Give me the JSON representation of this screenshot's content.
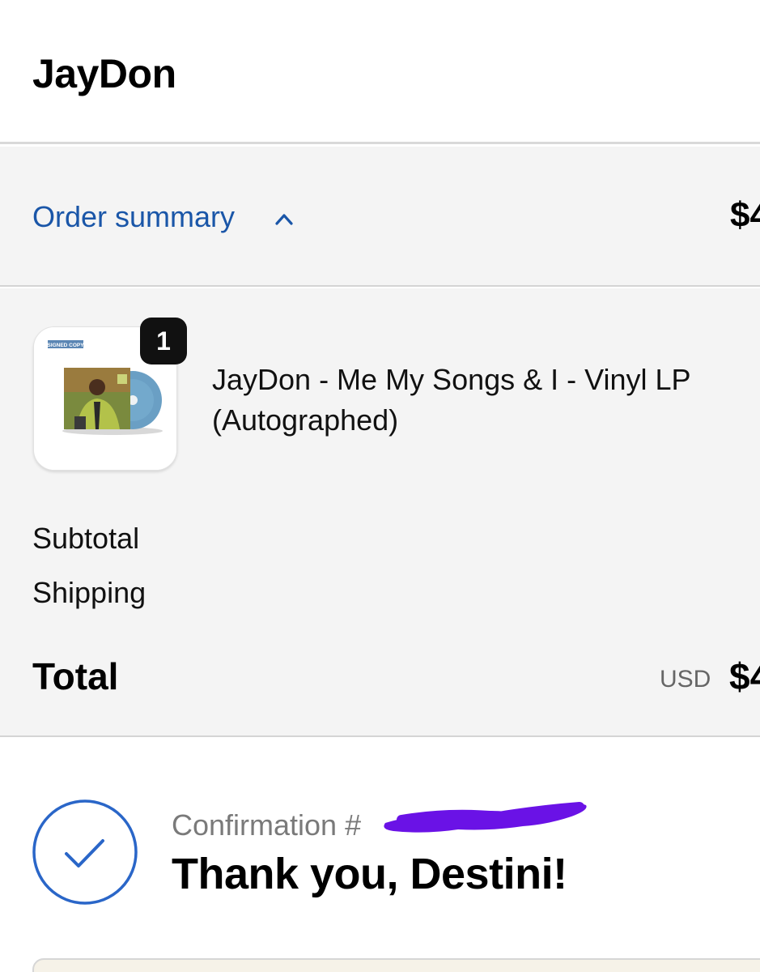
{
  "header": {
    "store_name": "JayDon"
  },
  "summary_toggle": {
    "label": "Order summary",
    "price": "$4"
  },
  "order": {
    "items": [
      {
        "quantity": "1",
        "name": "JayDon - Me My Songs & I - Vinyl LP (Autographed)",
        "thumbnail_tag": "SIGNED COPY"
      }
    ],
    "subtotal_label": "Subtotal",
    "shipping_label": "Shipping",
    "total_label": "Total",
    "currency": "USD",
    "total_price": "$4"
  },
  "confirmation": {
    "number_label": "Confirmation #",
    "thanks": "Thank you, Destini!"
  },
  "colors": {
    "link_blue": "#1a56a8",
    "check_blue": "#2a66c8",
    "redact_purple": "#6a12e6",
    "panel_gray": "#f4f4f4"
  },
  "icons": [
    "chevron-up-icon",
    "check-circle-icon"
  ]
}
